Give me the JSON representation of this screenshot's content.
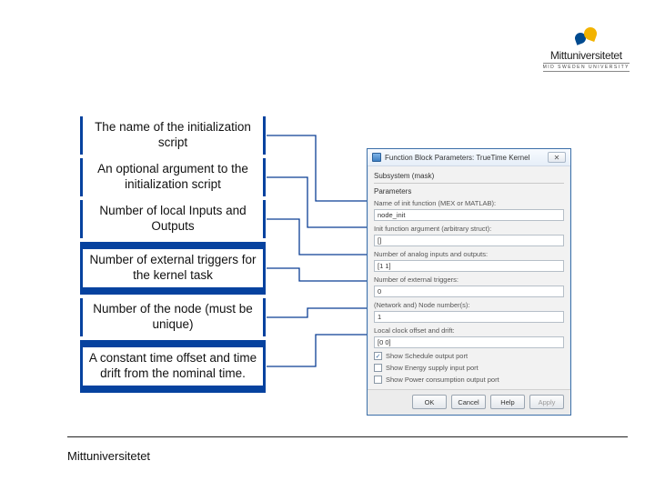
{
  "logo": {
    "name": "Mittuniversitetet",
    "subtitle": "MID SWEDEN UNIVERSITY"
  },
  "callouts": [
    "The name of the initialization script",
    "An optional argument to the initialization script",
    "Number of local Inputs and Outputs",
    "Number of external triggers for the kernel task",
    "Number of the node (must be unique)",
    "A constant time offset and time drift from the nominal time."
  ],
  "dialog": {
    "title": "Function Block Parameters: TrueTime Kernel",
    "subsystem": "Subsystem (mask)",
    "section": "Parameters",
    "labels": {
      "init_fn": "Name of init function (MEX or MATLAB):",
      "init_arg": "Init function argument (arbitrary struct):",
      "analog_io": "Number of analog inputs and outputs:",
      "triggers": "Number of external triggers:",
      "node_num": "(Network and) Node number(s):",
      "clock": "Local clock offset and drift:"
    },
    "values": {
      "init_fn": "node_init",
      "init_arg": "[]",
      "analog_io": "[1 1]",
      "triggers": "0",
      "node_num": "1",
      "clock": "[0 0]"
    },
    "checks": {
      "schedule": {
        "checked": true,
        "label": "Show Schedule output port"
      },
      "energy": {
        "checked": false,
        "label": "Show Energy supply input port"
      },
      "power": {
        "checked": false,
        "label": "Show Power consumption output port"
      }
    },
    "buttons": {
      "ok": "OK",
      "cancel": "Cancel",
      "help": "Help",
      "apply": "Apply"
    }
  },
  "footer": "Mittuniversitetet"
}
